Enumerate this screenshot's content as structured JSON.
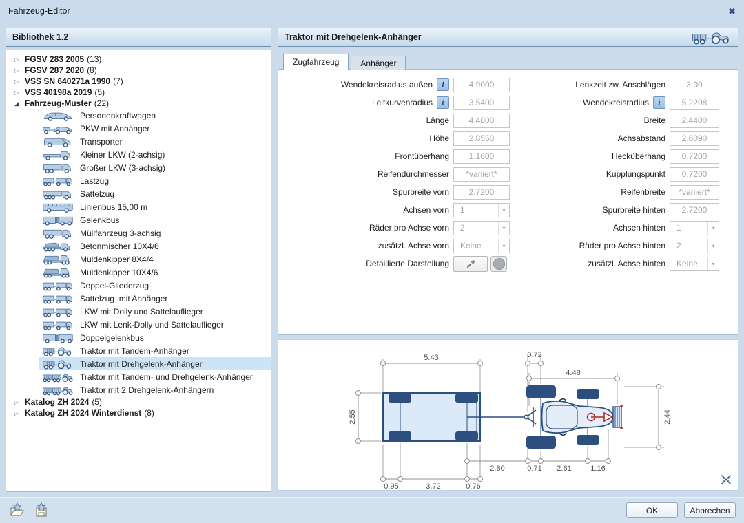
{
  "window": {
    "title": "Fahrzeug-Editor"
  },
  "icons": {
    "info": "i",
    "dropdown_arrow": "▾",
    "close": "✖",
    "expander_collapsed": "▷",
    "expander_expanded": "◢"
  },
  "library": {
    "header": "Bibliothek 1.2",
    "tree": [
      {
        "type": "group",
        "state": "collapsed",
        "label": "FGSV 283 2005",
        "count": "(13)"
      },
      {
        "type": "group",
        "state": "collapsed",
        "label": "FGSV 287 2020",
        "count": "(8)"
      },
      {
        "type": "group",
        "state": "collapsed",
        "label": "VSS SN 640271a 1990",
        "count": "(7)"
      },
      {
        "type": "group",
        "state": "collapsed",
        "label": "VSS 40198a 2019",
        "count": "(5)"
      },
      {
        "type": "group",
        "state": "expanded",
        "label": "Fahrzeug-Muster",
        "count": "(22)"
      },
      {
        "type": "item",
        "icon": "car",
        "label": "Personenkraftwagen"
      },
      {
        "type": "item",
        "icon": "car-trailer",
        "label": "PKW mit Anhänger"
      },
      {
        "type": "item",
        "icon": "van",
        "label": "Transporter"
      },
      {
        "type": "item",
        "icon": "truck-s",
        "label": "Kleiner LKW (2-achsig)"
      },
      {
        "type": "item",
        "icon": "truck-l",
        "label": "Großer LKW (3-achsig)"
      },
      {
        "type": "item",
        "icon": "truck-trailer",
        "label": "Lastzug"
      },
      {
        "type": "item",
        "icon": "semi",
        "label": "Sattelzug"
      },
      {
        "type": "item",
        "icon": "bus",
        "label": "Linienbus 15,00 m"
      },
      {
        "type": "item",
        "icon": "artic-bus",
        "label": "Gelenkbus"
      },
      {
        "type": "item",
        "icon": "truck-l",
        "label": "Müllfahrzeug 3-achsig"
      },
      {
        "type": "item",
        "icon": "mixer",
        "label": "Betonmischer 10X4/6"
      },
      {
        "type": "item",
        "icon": "dumper",
        "label": "Muldenkipper 8X4/4"
      },
      {
        "type": "item",
        "icon": "dumper",
        "label": "Muldenkipper 10X4/6"
      },
      {
        "type": "item",
        "icon": "truck-trailer",
        "label": "Doppel-Gliederzug"
      },
      {
        "type": "item",
        "icon": "truck-trailer",
        "label": "Sattelzug  mit Anhänger"
      },
      {
        "type": "item",
        "icon": "truck-trailer",
        "label": "LKW mit Dolly und Sattelauflieger"
      },
      {
        "type": "item",
        "icon": "truck-trailer",
        "label": "LKW mit Lenk-Dolly und Sattelauflieger"
      },
      {
        "type": "item",
        "icon": "artic-bus",
        "label": "Doppelgelenkbus"
      },
      {
        "type": "item",
        "icon": "tractor",
        "label": "Traktor mit Tandem-Anhänger"
      },
      {
        "type": "item",
        "icon": "tractor",
        "label": "Traktor mit Drehgelenk-Anhänger",
        "selected": true
      },
      {
        "type": "item",
        "icon": "tractor2",
        "label": "Traktor mit Tandem- und Drehgelenk-Anhänger"
      },
      {
        "type": "item",
        "icon": "tractor2",
        "label": "Traktor mit 2 Drehgelenk-Anhängern"
      },
      {
        "type": "group",
        "state": "collapsed",
        "label": "Katalog ZH 2024",
        "count": "(5)"
      },
      {
        "type": "group",
        "state": "collapsed",
        "label": "Katalog ZH 2024 Winterdienst",
        "count": "(8)"
      }
    ]
  },
  "editor": {
    "header": "Traktor mit Drehgelenk-Anhänger",
    "tabs": [
      {
        "label": "Zugfahrzeug",
        "active": true
      },
      {
        "label": "Anhänger",
        "active": false
      }
    ],
    "form": {
      "left": [
        {
          "label": "Wendekreisradius außen",
          "info": true,
          "type": "text",
          "value": "4.9000"
        },
        {
          "label": "Leitkurvenradius",
          "info": true,
          "type": "text",
          "value": "3.5400"
        },
        {
          "label": "Länge",
          "type": "text",
          "value": "4.4800"
        },
        {
          "label": "Höhe",
          "type": "text",
          "value": "2.8550"
        },
        {
          "label": "Frontüberhang",
          "type": "text",
          "value": "1.1600"
        },
        {
          "label": "Reifendurchmesser",
          "type": "text",
          "value": "*variiert*"
        },
        {
          "label": "Spurbreite vorn",
          "type": "text",
          "value": "2.7200"
        },
        {
          "label": "Achsen vorn",
          "type": "select",
          "value": "1"
        },
        {
          "label": "Räder pro Achse vorn",
          "type": "select",
          "value": "2"
        },
        {
          "label": "zusätzl. Achse vorn",
          "type": "select",
          "value": "Keine"
        },
        {
          "label": "Detaillierte Darstellung",
          "type": "buttons"
        }
      ],
      "right": [
        {
          "label": "Lenkzeit zw. Anschlägen",
          "type": "text",
          "value": "3.00"
        },
        {
          "label": "Wendekreisradius",
          "info": true,
          "type": "text",
          "value": "5.2208"
        },
        {
          "label": "Breite",
          "type": "text",
          "value": "2.4400"
        },
        {
          "label": "Achsabstand",
          "type": "text",
          "value": "2.6090"
        },
        {
          "label": "Hecküberhang",
          "type": "text",
          "value": "0.7200"
        },
        {
          "label": "Kupplungspunkt",
          "type": "text",
          "value": "0.7200"
        },
        {
          "label": "Reifenbreite",
          "type": "text",
          "value": "*variiert*"
        },
        {
          "label": "Spurbreite hinten",
          "type": "text",
          "value": "2.7200"
        },
        {
          "label": "Achsen hinten",
          "type": "select",
          "value": "1"
        },
        {
          "label": "Räder pro Achse hinten",
          "type": "select",
          "value": "2"
        },
        {
          "label": "zusätzl. Achse hinten",
          "type": "select",
          "value": "Keine"
        }
      ]
    },
    "diagram": {
      "dimensions": {
        "trailer_length": "5.43",
        "trailer_width": "2.55",
        "trailer_front_overhang": "0.95",
        "trailer_wheelbase": "3.72",
        "trailer_rear_overhang": "0.76",
        "hitch_to_axle": "2.80",
        "tractor_hitch_overhang": "0.72",
        "tractor_length": "4.48",
        "tractor_width": "2.44",
        "tractor_rear_overhang": "0.71",
        "tractor_wheelbase": "2.61",
        "tractor_front_overhang": "1.16"
      }
    }
  },
  "footer": {
    "ok": "OK",
    "cancel": "Abbrechen"
  },
  "colors": {
    "accent": "#2d5c88",
    "selection": "#cde4f7",
    "navy": "#2d4f80",
    "red_marker": "#b02020",
    "dialog_bg": "#ccdbeb"
  }
}
